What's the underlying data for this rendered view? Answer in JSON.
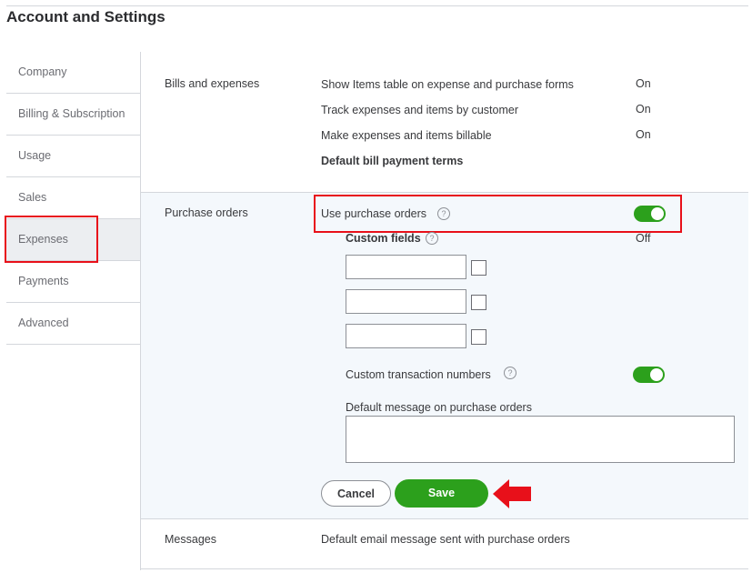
{
  "page_title": "Account and Settings",
  "sidebar": {
    "items": [
      {
        "label": "Company"
      },
      {
        "label": "Billing & Subscription"
      },
      {
        "label": "Usage"
      },
      {
        "label": "Sales"
      },
      {
        "label": "Expenses",
        "active": true
      },
      {
        "label": "Payments"
      },
      {
        "label": "Advanced"
      }
    ]
  },
  "bills_section": {
    "label": "Bills and expenses",
    "rows": [
      {
        "text": "Show Items table on expense and purchase forms",
        "value": "On"
      },
      {
        "text": "Track expenses and items by customer",
        "value": "On"
      },
      {
        "text": "Make expenses and items billable",
        "value": "On"
      },
      {
        "text": "Default bill payment terms",
        "value": ""
      }
    ]
  },
  "po_section": {
    "label": "Purchase orders",
    "use_po_label": "Use purchase orders",
    "use_po_enabled": true,
    "custom_fields_label": "Custom fields",
    "custom_fields_value": "Off",
    "custom_txn_label": "Custom transaction numbers",
    "custom_txn_enabled": true,
    "default_message_label": "Default message on purchase orders",
    "default_message_value": "",
    "cancel_label": "Cancel",
    "save_label": "Save",
    "help_glyph": "?"
  },
  "messages_section": {
    "label": "Messages",
    "text": "Default email message sent with purchase orders"
  },
  "colors": {
    "accent_green": "#2ca01c",
    "annotation_red": "#e8101a"
  }
}
